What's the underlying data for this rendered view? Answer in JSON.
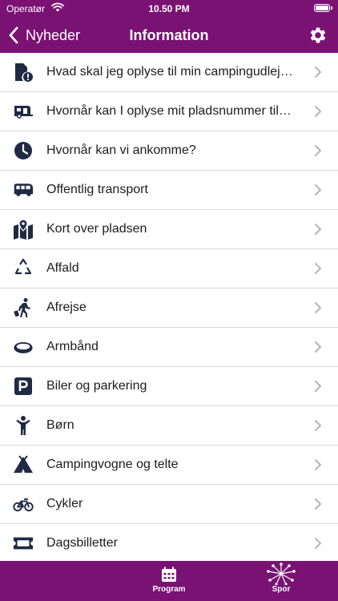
{
  "status_bar": {
    "carrier": "Operatør",
    "time": "10.50 PM"
  },
  "header": {
    "back_label": "Nyheder",
    "title": "Information"
  },
  "list": {
    "items": [
      {
        "label": "Hvad skal jeg oplyse til min campingudlejer?",
        "icon": "document-alert-icon"
      },
      {
        "label": "Hvornår kan I oplyse mit pladsnummer til mig?",
        "icon": "caravan-icon"
      },
      {
        "label": "Hvornår kan vi ankomme?",
        "icon": "clock-icon"
      },
      {
        "label": "Offentlig transport",
        "icon": "bus-icon"
      },
      {
        "label": "Kort over pladsen",
        "icon": "map-icon"
      },
      {
        "label": "Affald",
        "icon": "recycle-icon"
      },
      {
        "label": "Afrejse",
        "icon": "traveler-icon"
      },
      {
        "label": "Armbånd",
        "icon": "wristband-icon"
      },
      {
        "label": "Biler og parkering",
        "icon": "parking-icon"
      },
      {
        "label": "Børn",
        "icon": "child-icon"
      },
      {
        "label": "Campingvogne og telte",
        "icon": "tent-icon"
      },
      {
        "label": "Cykler",
        "icon": "bicycle-icon"
      },
      {
        "label": "Dagsbilletter",
        "icon": "ticket-icon"
      }
    ]
  },
  "tabbar": {
    "program_label": "Program",
    "spor_label": "Spor"
  },
  "colors": {
    "brand": "#7a1273",
    "icon": "#1f2a44",
    "chevron": "#b5b5b5"
  }
}
